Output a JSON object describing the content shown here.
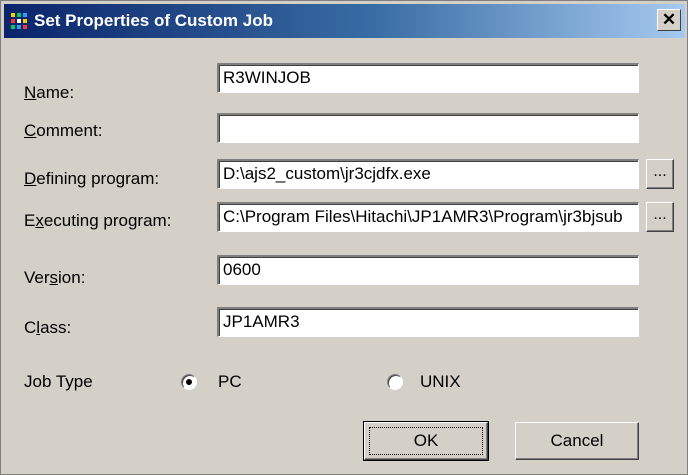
{
  "window": {
    "title": "Set Properties of Custom Job",
    "close_label": "✕"
  },
  "form": {
    "name": {
      "label_key": "N",
      "label_rest": "ame:",
      "value": "R3WINJOB"
    },
    "comment": {
      "label_key": "C",
      "label_rest": "omment:",
      "value": ""
    },
    "defining_program": {
      "label_key": "D",
      "label_rest": "efining program:",
      "value": "D:\\ajs2_custom\\jr3cjdfx.exe",
      "browse_label": "..."
    },
    "executing_program": {
      "label_pre": "E",
      "label_key": "x",
      "label_rest": "ecuting program:",
      "value": "C:\\Program Files\\Hitachi\\JP1AMR3\\Program\\jr3bjsub",
      "browse_label": "..."
    },
    "version": {
      "label_pre": "Ver",
      "label_key": "s",
      "label_rest": "ion:",
      "value": "0600"
    },
    "class": {
      "label_pre": "C",
      "label_key": "l",
      "label_rest": "ass:",
      "value": "JP1AMR3"
    }
  },
  "job_type": {
    "label": "Job Type",
    "options": [
      {
        "label": "PC",
        "selected": true
      },
      {
        "label": "UNIX",
        "selected": false
      }
    ]
  },
  "buttons": {
    "ok": "OK",
    "cancel": "Cancel"
  },
  "colors": {
    "title_gradient_start": "#0a246a",
    "title_gradient_end": "#a6caf0",
    "dialog_face": "#d4d0c8"
  }
}
